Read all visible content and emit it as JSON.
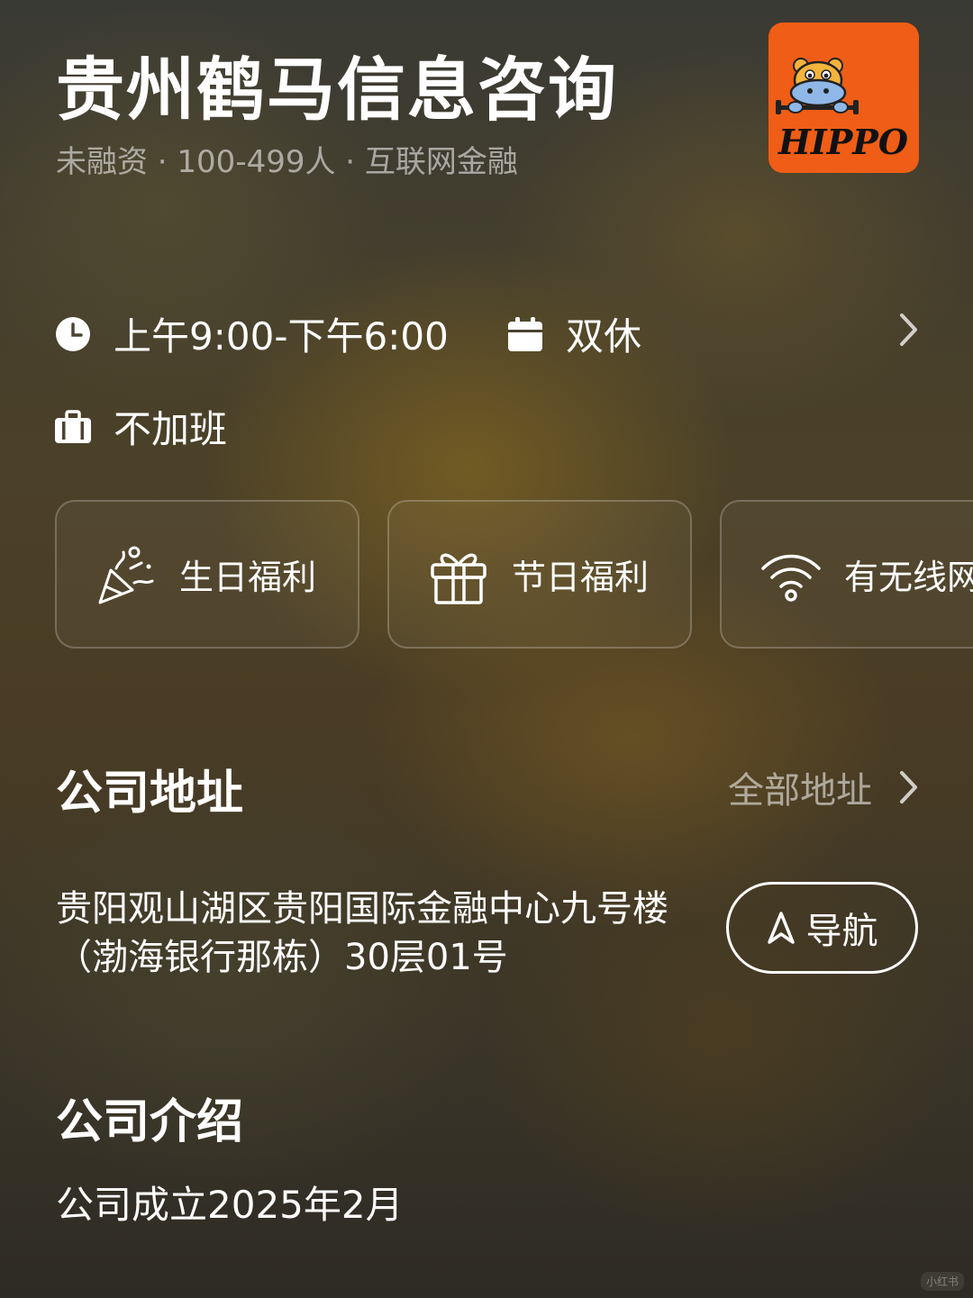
{
  "company": {
    "name": "贵州鹤马信息咨询",
    "meta": "未融资 · 100-499人 · 互联网金融",
    "logo_text": "HIPPO",
    "logo_color": "#ef5d16"
  },
  "work_info": {
    "hours": "上午9:00-下午6:00",
    "rest": "双休",
    "overtime": "不加班",
    "icons": [
      "clock-icon",
      "calendar-icon",
      "briefcase-icon",
      "chevron-right-icon"
    ]
  },
  "benefits": [
    {
      "label": "生日福利",
      "icon": "party-popper-icon"
    },
    {
      "label": "节日福利",
      "icon": "gift-icon"
    },
    {
      "label": "有无线网",
      "icon": "wifi-icon"
    }
  ],
  "address_section": {
    "title": "公司地址",
    "all_link": "全部地址",
    "address": "贵阳观山湖区贵阳国际金融中心九号楼（渤海银行那栋）30层01号",
    "nav_label": "导航"
  },
  "intro_section": {
    "title": "公司介绍",
    "text": "公司成立2025年2月"
  },
  "watermark": "小红书"
}
